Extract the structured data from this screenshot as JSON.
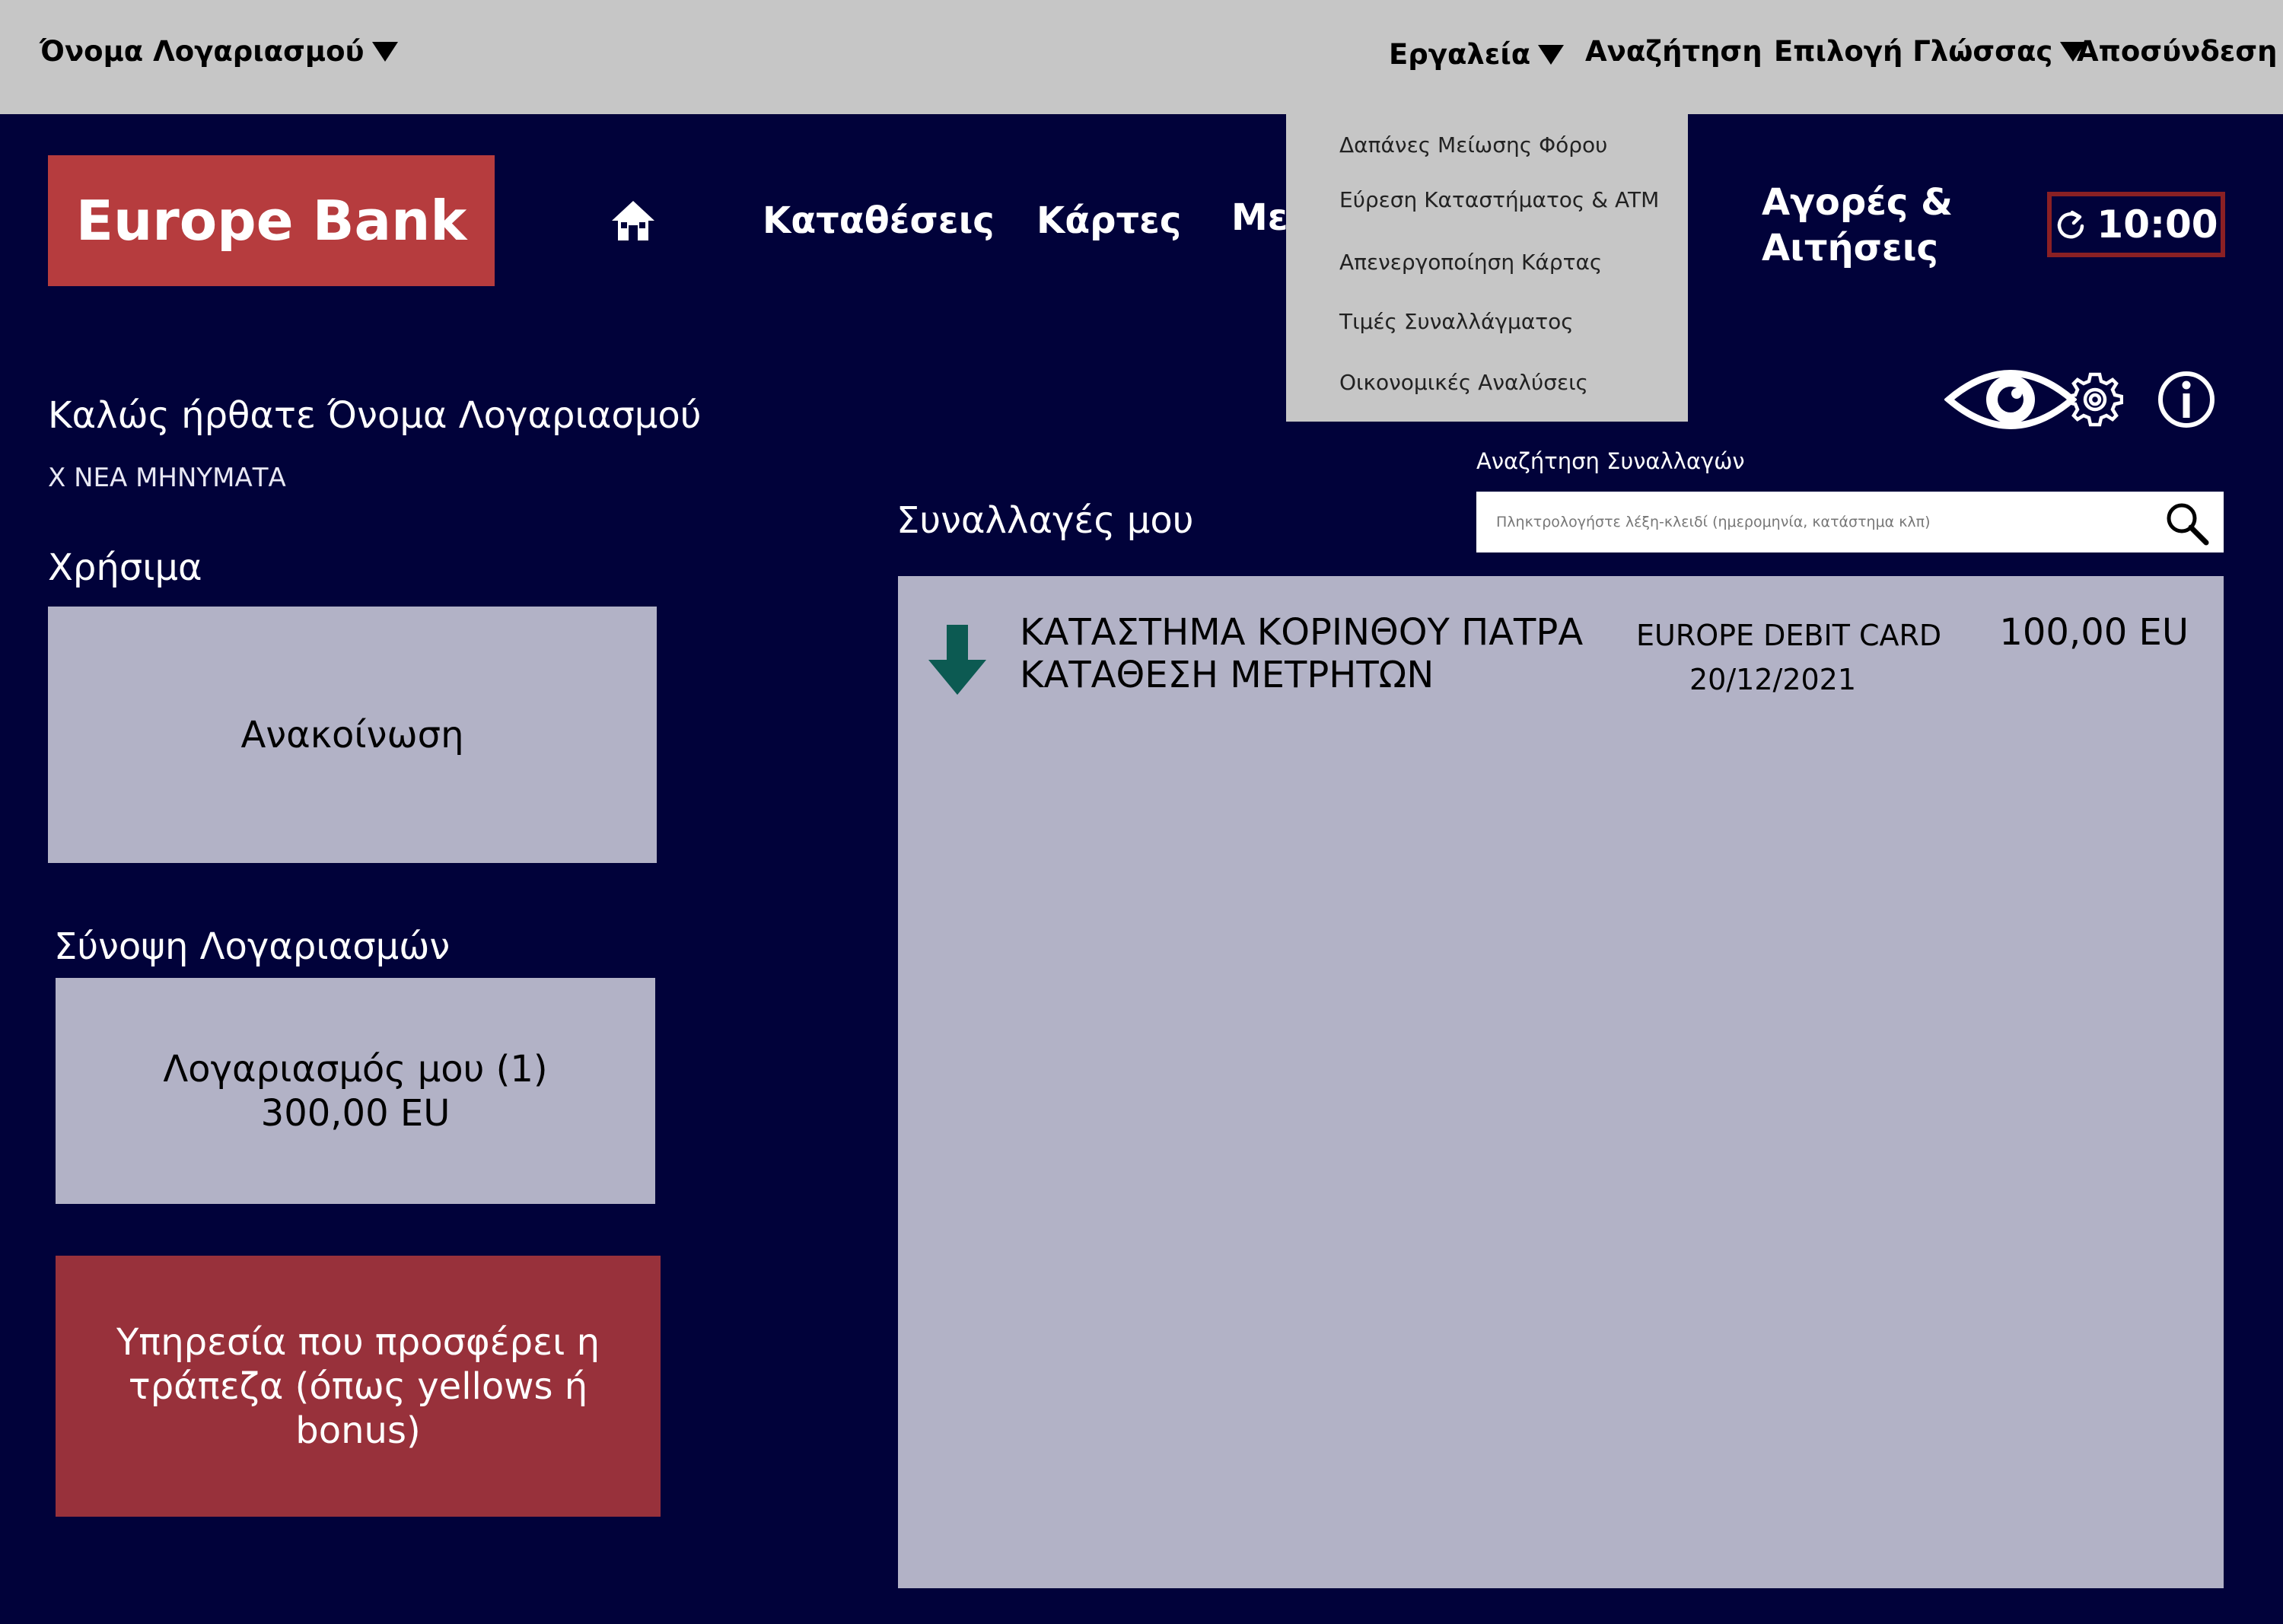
{
  "topbar": {
    "account_name": "Όνομα Λογαριασμού",
    "tools": "Εργαλεία",
    "search": "Αναζήτηση",
    "language": "Επιλογή Γλώσσας",
    "logout": "Αποσύνδεση"
  },
  "brand": {
    "name": "Europe Bank"
  },
  "nav": {
    "home_icon": "home-icon",
    "deposits": "Καταθέσεις",
    "cards": "Κάρτες",
    "hidden_partial": "Με",
    "purchases_line1": "Αγορές &",
    "purchases_line2": "Αιτήσεις"
  },
  "session": {
    "refresh_icon": "refresh-icon",
    "time": "10:00"
  },
  "tools_menu": {
    "items": [
      "Δαπάνες Μείωσης Φόρου",
      "Εύρεση Καταστήματος & ATM",
      "Απενεργοποίηση Κάρτας",
      "Τιμές Συναλλάγματος",
      "Οικονομικές Αναλύσεις"
    ]
  },
  "welcome": {
    "greeting": "Καλώς ήρθατε Όνομα Λογαριασμού",
    "messages": "Χ ΝΕΑ ΜΗΝΥΜΑΤΑ"
  },
  "useful": {
    "title": "Χρήσιμα",
    "announcement": "Ανακοίνωση"
  },
  "accounts": {
    "title": "Σύνοψη Λογαριασμών",
    "account_name": "Λογαριασμός μου (1)",
    "balance": "300,00 EU"
  },
  "promo": {
    "text": "Υπηρεσία που προσφέρει η τράπεζα (όπως yellows ή bonus)"
  },
  "toolbar_icons": [
    "eye-icon",
    "gear-icon",
    "info-icon"
  ],
  "transactions_search": {
    "label": "Αναζήτηση Συναλλαγών",
    "placeholder": "Πληκτρολογήστε λέξη-κλειδί (ημερομηνία, κατάστημα κλπ)"
  },
  "transactions": {
    "title": "Συναλλαγές μου",
    "rows": [
      {
        "direction_icon": "arrow-down-icon",
        "merchant": "ΚΑΤΑΣΤΗΜΑ ΚΟΡΙΝΘΟΥ ΠΑΤΡΑ",
        "type": "ΚΑΤΑΘΕΣΗ ΜΕΤΡΗΤΩΝ",
        "card": "EUROPE DEBIT CARD",
        "date": "20/12/2021",
        "amount": "100,00 EU"
      }
    ]
  },
  "colors": {
    "background": "#01023a",
    "topbar": "#c6c6c6",
    "brand_red": "#b63c3e",
    "promo_red": "#98313b",
    "card_grey": "#b2b2c6",
    "deposit_arrow": "#0c5a52",
    "timer_border": "#8a2024"
  }
}
